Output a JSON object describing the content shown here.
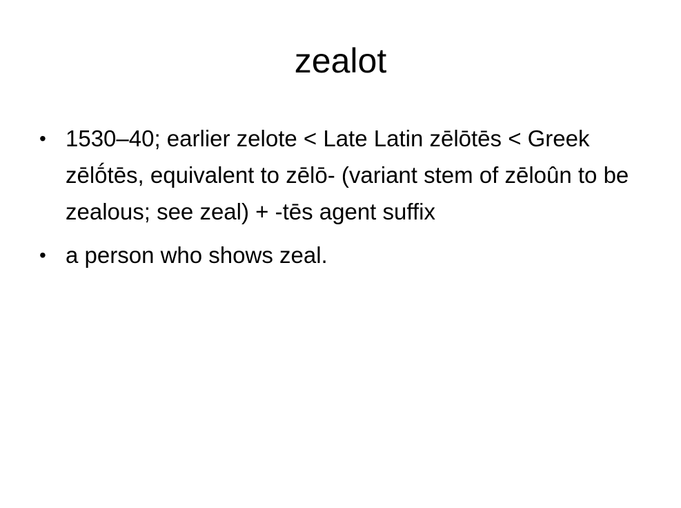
{
  "slide": {
    "title": "zealot",
    "bullets": [
      {
        "symbol": "•",
        "text": "1530–40; earlier zelote < Late Latin zēlōtēs < Greek zēlṓtēs, equivalent to zēlō- (variant stem of zēloûn to be zealous; see zeal) + -tēs agent suffix"
      },
      {
        "symbol": "•",
        "text": "a person who shows zeal."
      }
    ]
  }
}
